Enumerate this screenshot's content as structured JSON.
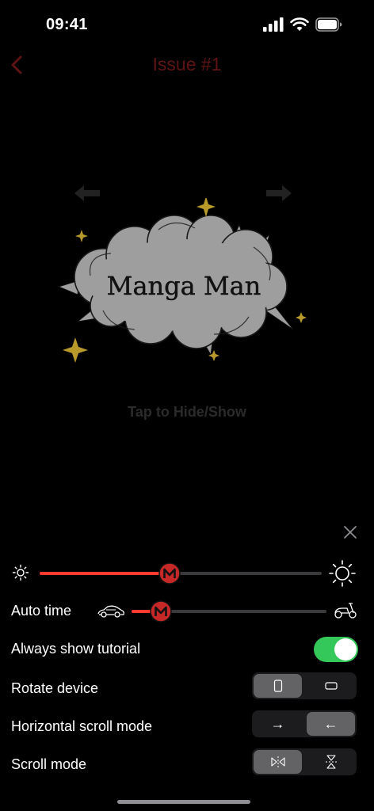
{
  "status_bar": {
    "time": "09:41",
    "battery_icon": "battery-icon",
    "wifi_icon": "wifi-icon",
    "signal_icon": "signal-icon"
  },
  "nav": {
    "title": "Issue #1",
    "back_icon": "chevron-left-icon"
  },
  "preview": {
    "logo_text": "Manga Man",
    "hint": "Tap to Hide/Show",
    "prev_icon": "arrow-left-icon",
    "next_icon": "arrow-right-icon"
  },
  "panel": {
    "close_icon": "close-icon",
    "brightness": {
      "level": 0.46,
      "min_icon": "sun-small-icon",
      "max_icon": "sun-large-icon"
    },
    "auto_time": {
      "label": "Auto time",
      "level": 0.15,
      "fast_icon": "car-icon",
      "slow_icon": "scooter-icon"
    },
    "tutorial": {
      "label": "Always show tutorial",
      "on": true
    },
    "rotate": {
      "label": "Rotate device",
      "options": [
        "portrait-icon",
        "landscape-icon"
      ],
      "selected": 0
    },
    "horizontal_scroll": {
      "label": "Horizontal scroll mode",
      "options": [
        "→",
        "←"
      ],
      "selected": 1
    },
    "scroll_mode": {
      "label": "Scroll mode",
      "options": [
        "horizontal-flip-icon",
        "vertical-flip-icon"
      ],
      "selected": 0
    }
  },
  "colors": {
    "accent": "#ff3b30",
    "toggle_on": "#34c759",
    "title": "#5e1414",
    "sparkle": "#b89a2b"
  }
}
